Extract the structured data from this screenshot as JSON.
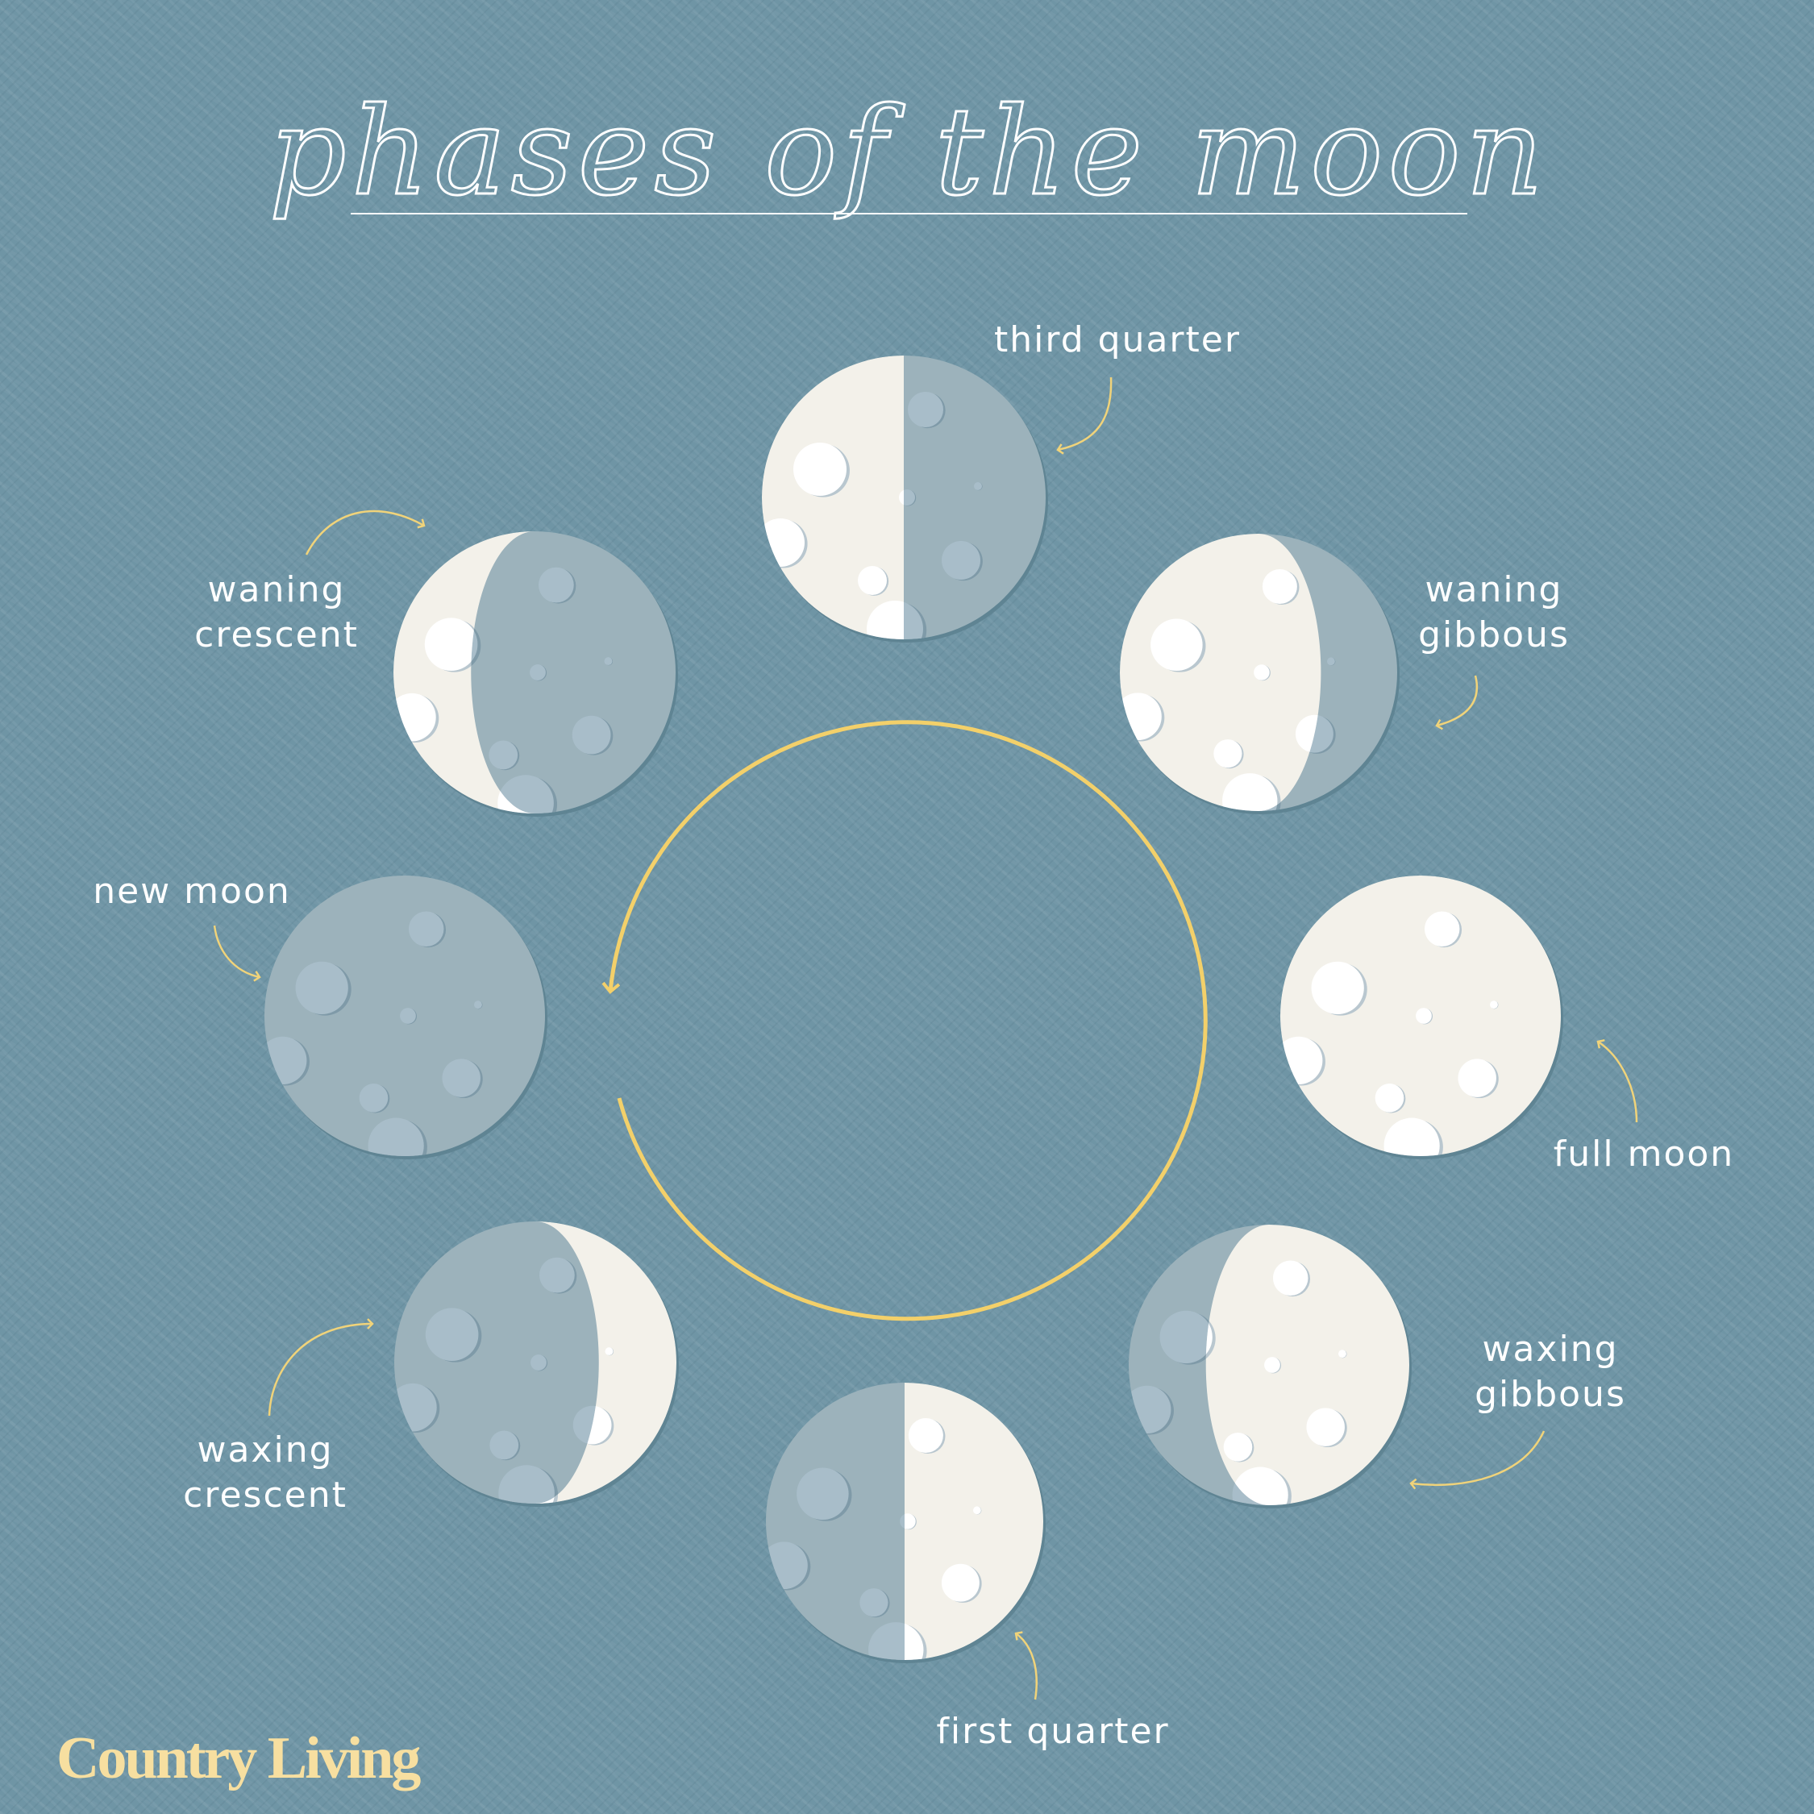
{
  "title": "phases of the moon",
  "brand": "Country Living",
  "colors": {
    "background": "#6f95a5",
    "moon_lit": "#f3f1ea",
    "moon_dark": "#9cb2bb",
    "cycle_ring": "#f3d06a",
    "label": "#ffffff",
    "brand": "#f7dfa0"
  },
  "phases": [
    {
      "id": "third-quarter",
      "lines": [
        "third quarter"
      ],
      "lit_side": "left",
      "k": 0
    },
    {
      "id": "waning-gibbous",
      "lines": [
        "waning",
        "gibbous"
      ],
      "lit_side": "left",
      "k": 0.45
    },
    {
      "id": "full-moon",
      "lines": [
        "full moon"
      ],
      "lit_side": "left",
      "k": 1
    },
    {
      "id": "waxing-gibbous",
      "lines": [
        "waxing",
        "gibbous"
      ],
      "lit_side": "right",
      "k": 0.45
    },
    {
      "id": "first-quarter",
      "lines": [
        "first quarter"
      ],
      "lit_side": "right",
      "k": 0
    },
    {
      "id": "waxing-crescent",
      "lines": [
        "waxing",
        "crescent"
      ],
      "lit_side": "right",
      "k": -0.45
    },
    {
      "id": "new-moon",
      "lines": [
        "new moon"
      ],
      "lit_side": "right",
      "k": -1
    },
    {
      "id": "waning-crescent",
      "lines": [
        "waning",
        "crescent"
      ],
      "lit_side": "left",
      "k": -0.45
    }
  ]
}
